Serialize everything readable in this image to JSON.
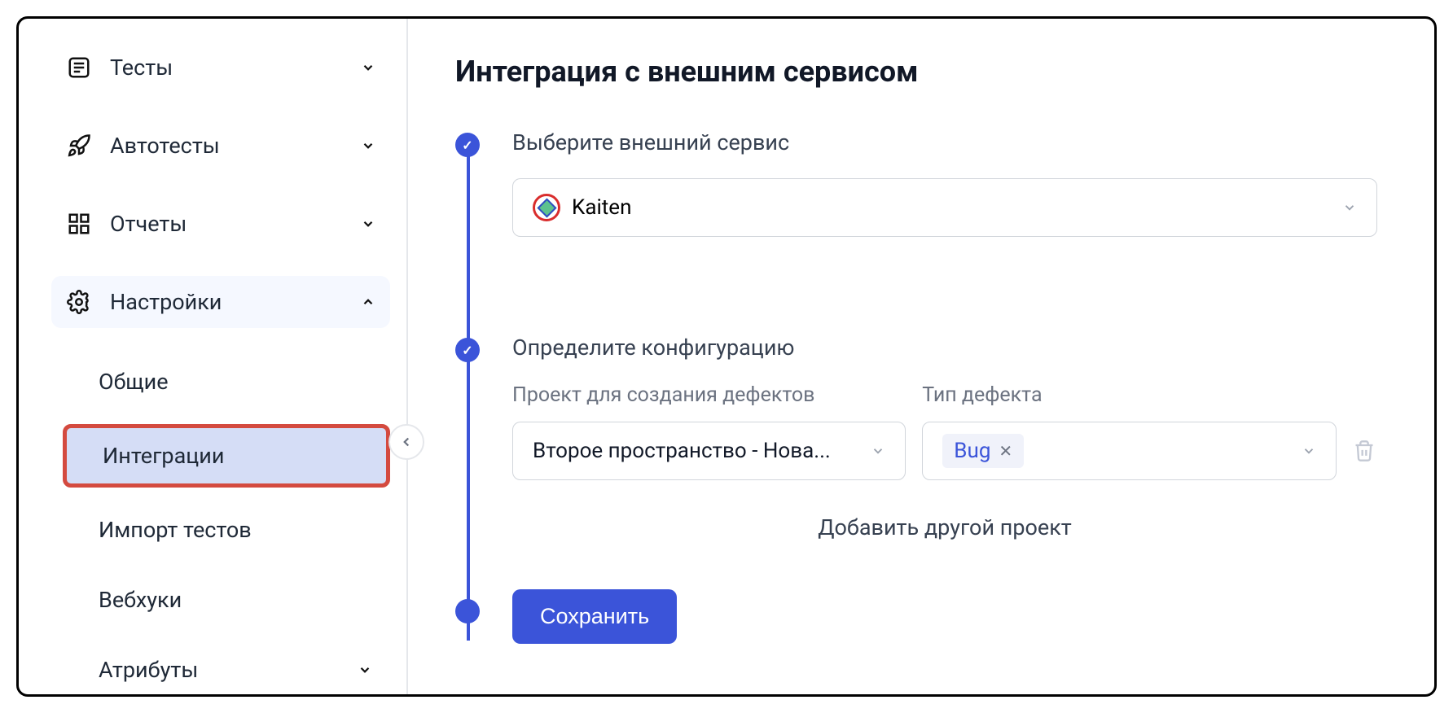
{
  "sidebar": {
    "items": [
      {
        "label": "Тесты",
        "icon": "list-icon",
        "expanded": false
      },
      {
        "label": "Автотесты",
        "icon": "rocket-icon",
        "expanded": false
      },
      {
        "label": "Отчеты",
        "icon": "grid-icon",
        "expanded": false
      },
      {
        "label": "Настройки",
        "icon": "gear-icon",
        "expanded": true
      }
    ],
    "settings_sub": [
      {
        "label": "Общие",
        "active": false
      },
      {
        "label": "Интеграции",
        "active": true
      },
      {
        "label": "Импорт тестов",
        "active": false
      },
      {
        "label": "Вебхуки",
        "active": false
      },
      {
        "label": "Атрибуты",
        "active": false,
        "has_chev": true
      }
    ]
  },
  "main": {
    "title": "Интеграция с внешним сервисом",
    "step1": {
      "title": "Выберите внешний сервис",
      "selected": "Kaiten"
    },
    "step2": {
      "title": "Определите конфигурацию",
      "col1_header": "Проект для создания дефектов",
      "col2_header": "Тип дефекта",
      "project_value": "Второе пространство - Нова...",
      "type_tag": "Bug",
      "add_more": "Добавить другой проект"
    },
    "save_label": "Сохранить"
  }
}
